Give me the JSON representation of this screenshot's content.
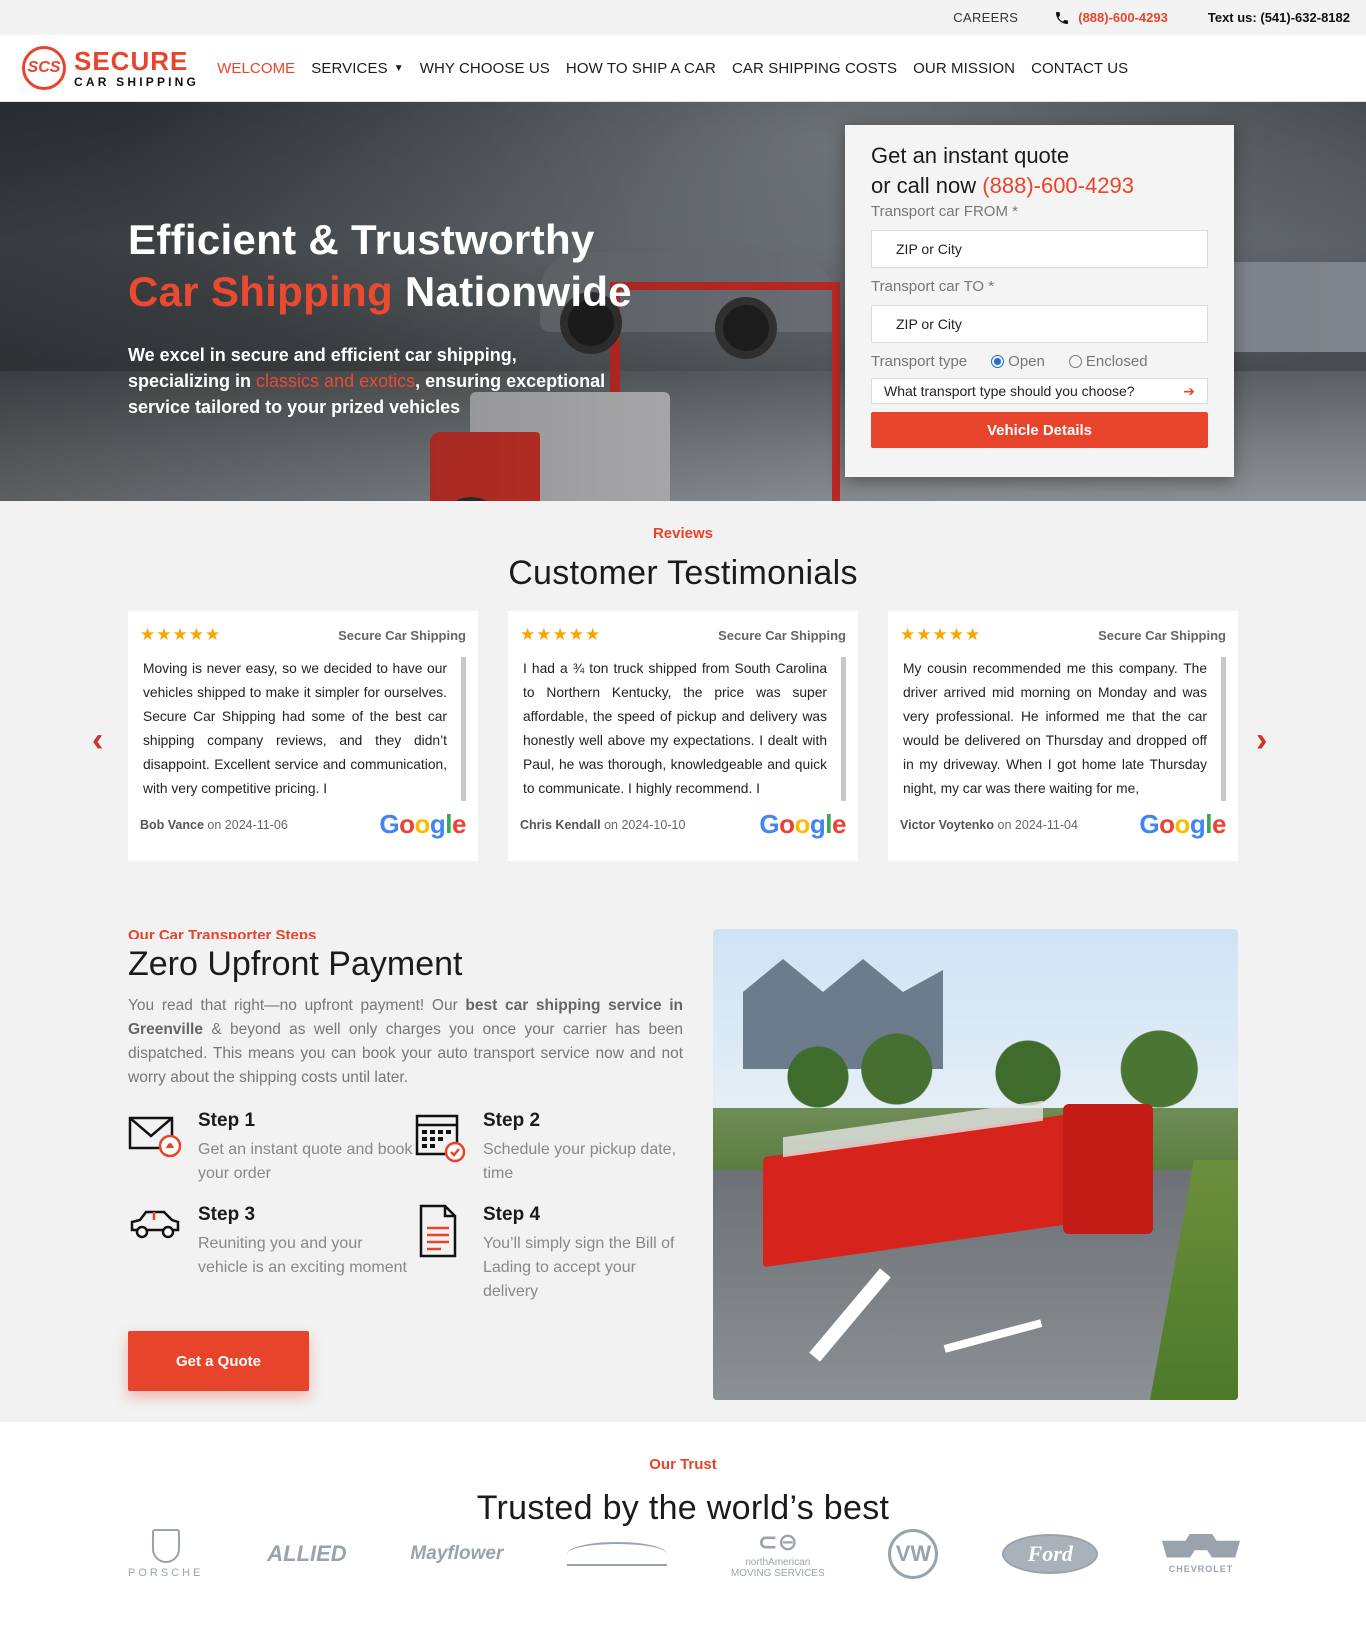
{
  "topbar": {
    "careers": "CAREERS",
    "phone": "(888)-600-4293",
    "text_label": "Text us:",
    "text_number": "(541)-632-8182"
  },
  "logo": {
    "mark": "SCS",
    "line1": "SECURE",
    "line2": "CAR SHIPPING"
  },
  "nav": {
    "items": [
      {
        "label": "WELCOME",
        "active": true
      },
      {
        "label": "SERVICES",
        "dropdown": true
      },
      {
        "label": "WHY CHOOSE US"
      },
      {
        "label": "HOW TO SHIP A CAR"
      },
      {
        "label": "CAR SHIPPING COSTS"
      },
      {
        "label": "OUR MISSION"
      },
      {
        "label": "CONTACT US"
      }
    ]
  },
  "hero": {
    "title_line1": "Efficient & Trustworthy",
    "title_red": "Car Shipping",
    "title_rest": "Nationwide",
    "sub_before": "We excel in secure and efficient car shipping, specializing in",
    "sub_red": "classics and exotics",
    "sub_after": ", ensuring exceptional service tailored to your prized vehicles"
  },
  "quote_form": {
    "heading_line1": "Get an instant quote",
    "heading_line2": "or call now",
    "heading_phone": "(888)-600-4293",
    "from_label": "Transport car FROM *",
    "from_placeholder": "ZIP or City",
    "to_label": "Transport car TO *",
    "to_placeholder": "ZIP or City",
    "type_label": "Transport type",
    "type_options": [
      {
        "label": "Open",
        "selected": true
      },
      {
        "label": "Enclosed",
        "selected": false
      }
    ],
    "help_link": "What transport type should you choose?",
    "submit": "Vehicle Details"
  },
  "reviews": {
    "eyebrow": "Reviews",
    "title": "Customer Testimonials",
    "items": [
      {
        "stars": "★★★★★",
        "source": "Secure Car Shipping",
        "text": "Moving is never easy, so we decided to have our vehicles shipped to make it simpler for ourselves. Secure Car Shipping had some of the best car shipping company reviews, and they didn’t disappoint. Excellent service and communication, with very competitive pricing. I",
        "author": "Bob Vance",
        "date_prefix": "on",
        "date": "2024-11-06"
      },
      {
        "stars": "★★★★★",
        "source": "Secure Car Shipping",
        "text": "I had a ¾ ton truck shipped from South Carolina to Northern Kentucky, the price was super affordable, the speed of pickup and delivery was honestly well above my expectations. I dealt with Paul, he was thorough, knowledgeable and quick to communicate. I highly recommend. I",
        "author": "Chris Kendall",
        "date_prefix": "on",
        "date": "2024-10-10"
      },
      {
        "stars": "★★★★★",
        "source": "Secure Car Shipping",
        "text": "My cousin recommended me this company. The driver arrived mid morning on Monday and was very professional. He informed me that the car would be delivered on Thursday and dropped off in my driveway. When I got home late Thursday night, my car was there waiting for me,",
        "author": "Victor Voytenko",
        "date_prefix": "on",
        "date": "2024-11-04"
      }
    ],
    "prev_arrow": "‹",
    "next_arrow": "›"
  },
  "steps": {
    "eyebrow": "Our Car Transporter Steps",
    "title": "Zero Upfront Payment",
    "lead_1": "You read that right—no upfront payment! Our",
    "lead_bold": "best car shipping service in Greenville",
    "lead_2": "& beyond as well only charges you once your carrier has been dispatched. This means you can book your auto transport service now and not worry about the shipping costs until later.",
    "items": [
      {
        "title": "Step 1",
        "text": "Get an instant quote and book your order",
        "icon": "envelope-icon"
      },
      {
        "title": "Step 2",
        "text": "Schedule your pickup date, time",
        "icon": "calendar-icon"
      },
      {
        "title": "Step 3",
        "text": "Reuniting you and your vehicle is an exciting moment",
        "icon": "car-icon"
      },
      {
        "title": "Step 4",
        "text": "You’ll simply sign the Bill of Lading to accept your delivery",
        "icon": "document-icon"
      }
    ],
    "cta": "Get a Quote"
  },
  "trust": {
    "eyebrow": "Our Trust",
    "title": "Trusted by the world’s best",
    "logos": [
      {
        "name": "porsche-logo",
        "text": "PORSCHE"
      },
      {
        "name": "allied-logo",
        "text": "ALLIED"
      },
      {
        "name": "mayflower-logo",
        "text": "Mayflower"
      },
      {
        "name": "aston-martin-logo",
        "text": ""
      },
      {
        "name": "north-american-logo",
        "text": "northAmerican",
        "sub": "MOVING SERVICES"
      },
      {
        "name": "volkswagen-logo",
        "text": "VW"
      },
      {
        "name": "ford-logo",
        "text": "Ford"
      },
      {
        "name": "chevrolet-logo",
        "text": "CHEVROLET"
      }
    ]
  },
  "colors": {
    "accent": "#e8442b",
    "star": "#f9a400",
    "section_bg": "#f2f2f2"
  }
}
